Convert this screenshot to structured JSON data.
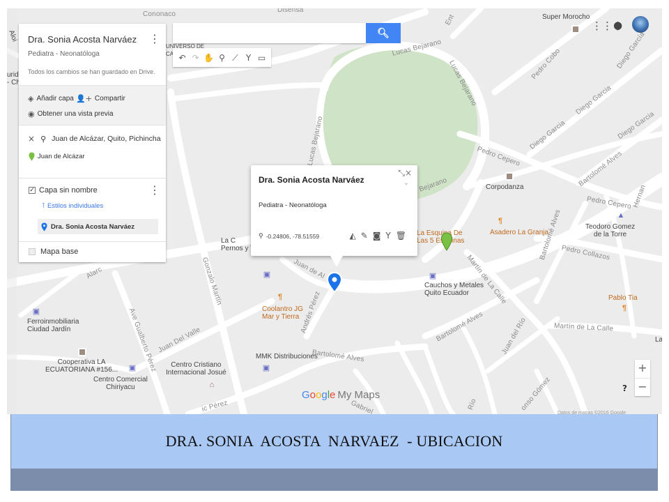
{
  "colors": {
    "map_bg": "#ececec",
    "road": "#ffffff",
    "park": "#cfe3c6",
    "search_button": "#4285f4",
    "marker_blue": "#1a73e8",
    "marker_green": "#7ac143",
    "caption_bg": "#a9c8f4",
    "footer_bg": "#7c8cab"
  },
  "search": {
    "value": "",
    "button_icon": "search-icon"
  },
  "toolbar": {
    "tools": [
      "undo-icon",
      "redo-icon",
      "hand-icon",
      "marker-icon",
      "polyline-icon",
      "route-icon",
      "ruler-icon"
    ]
  },
  "panel": {
    "title": "Dra. Sonia Acosta Narváez",
    "subtitle": "Pediatra - Neonatóloga",
    "saved_status": "Todos los cambios se han guardado en Drive.",
    "add_layer": "Añadir capa",
    "share": "Compartir",
    "preview": "Obtener una vista previa",
    "search_query": "Juan de Alcázar, Quito, Pichincha",
    "search_result": "Juan de Alcázar",
    "layer_name": "Capa sin nombre",
    "layer_styles": "Estilos individuales",
    "feature_name": "Dra. Sonia Acosta Narváez",
    "base_map": "Mapa base"
  },
  "infowindow": {
    "title": "Dra. Sonia Acosta Narváez",
    "description": "Pediatra - Neonatóloga",
    "coords": "-0.24806, -78.51559"
  },
  "map_labels": {
    "streets": {
      "cononaco": "Cononaco",
      "disensa": "Disensa",
      "lucas_bejarano_top": "Lucas Bejarano",
      "lucas_bejarano_right": "Lucas Bejarano",
      "lucas_bejarano_left": "Lucas Bejarano",
      "lucas_bejarano_mid": "Bejarano",
      "pedro_cobo": "Pedro Cobo",
      "diego_garcia_1": "Diego García",
      "diego_garcia_2": "Diego Garcia",
      "diego_garcia_3": "Diego Garcia",
      "diego_garcia_4": "Diego Garcia",
      "pedro_cepero_1": "Pedro Cepero",
      "pedro_cepero_2": "Pedro Cepero",
      "bartolome_alves_1": "Bartolomé Alves",
      "bartolome_alves_2": "Bartolomé Alves",
      "bartolome_alves_3": "Bartolomé Alves",
      "bartolome_alves_4": "Bartolomé Alves",
      "hernan": "Hernan",
      "pedro_collazos": "Pedro Collazos",
      "martin_calle_1": "Martín de La Calle",
      "martin_calle_2": "Martín de La Calle",
      "gonzalo_martin": "Gonzalo Martín",
      "ave_gualberto": "Ave Gualberto Pérez",
      "juan_del_valle": "Juan Del Valle",
      "andres_perez": "Andrés Pérez",
      "juan_de_al": "Juan de Al",
      "juan_del_rio": "Juan del Río",
      "alonso_gomez": "onso Gómez",
      "alarc": "Alarc",
      "gabriel": "Gabriel",
      "rio": "Río",
      "ic_perez": "ic Pérez",
      "ent": "Ent"
    },
    "places": {
      "super_morocho": "Super Morocho",
      "universo": "UNIVERSO DE\nCA",
      "urida": "urida\n- Ch",
      "aloi": "Aloi",
      "corpodanza": "Corpodanza",
      "la_esquina": "La Esquina De\nLas 5 Esquinas",
      "asadero": "Asadero La Granja",
      "teodoro": "Teodoro Gomez\nde la Torre",
      "cauchos": "Cauchos y Metales\nQuito Ecuador",
      "pablo_tia": "Pablo Tia",
      "la_c": "La C\nPernos y T",
      "coolantro": "Coolantro JG\nMar y Tierra",
      "ferroinmobiliaria": "Ferroinmobiliaria\nCiudad Jardín",
      "cooperativa": "Cooperativa LA\nECUATORIANA #156...",
      "centro_comercial": "Centro Comercial\nChiriyacu",
      "centro_cristiano": "Centro Cristiano\nInternacional Josué",
      "mmk": "MMK Distribuciones",
      "la_edge": "La"
    }
  },
  "logo": {
    "google": [
      "G",
      "o",
      "o",
      "g",
      "l",
      "e"
    ],
    "google_colors": [
      "#4285f4",
      "#ea4335",
      "#fbbc05",
      "#4285f4",
      "#34a853",
      "#ea4335"
    ],
    "product": "My Maps"
  },
  "attribution": "Datos de mapas ©2016 Google",
  "caption": "DRA. SONIA  ACOSTA  NARVAEZ  - UBICACION"
}
